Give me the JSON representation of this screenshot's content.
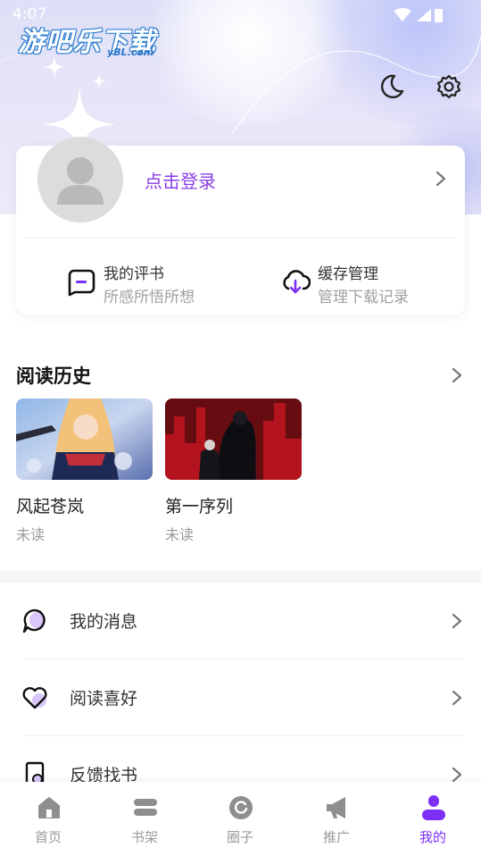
{
  "status_bar": {
    "time": "4:07"
  },
  "watermark": {
    "logo_text": "游吧乐下载",
    "logo_sub": "yBL.com"
  },
  "header": {
    "moon_icon": "moon-icon",
    "settings_icon": "gear-icon"
  },
  "profile_card": {
    "login_label": "点击登录",
    "shortcuts": [
      {
        "icon": "comment-box-icon",
        "title": "我的评书",
        "subtitle": "所感所悟所想"
      },
      {
        "icon": "cloud-download-icon",
        "title": "缓存管理",
        "subtitle": "管理下载记录"
      }
    ]
  },
  "reading_history": {
    "title": "阅读历史",
    "books": [
      {
        "title": "风起苍岚",
        "status": "未读"
      },
      {
        "title": "第一序列",
        "status": "未读"
      }
    ]
  },
  "menu": [
    {
      "icon": "message-bubble-icon",
      "label": "我的消息"
    },
    {
      "icon": "heart-icon",
      "label": "阅读喜好"
    },
    {
      "icon": "book-search-icon",
      "label": "反馈找书"
    }
  ],
  "tabs": [
    {
      "label": "首页",
      "icon": "home-icon",
      "active": false
    },
    {
      "label": "书架",
      "icon": "bookshelf-icon",
      "active": false
    },
    {
      "label": "圈子",
      "icon": "circle-icon",
      "active": false
    },
    {
      "label": "推广",
      "icon": "megaphone-icon",
      "active": false
    },
    {
      "label": "我的",
      "icon": "user-icon",
      "active": true
    }
  ],
  "colors": {
    "accent": "#7b2ff7",
    "login_text": "#8a3fe6",
    "muted": "#9a9a9a"
  }
}
